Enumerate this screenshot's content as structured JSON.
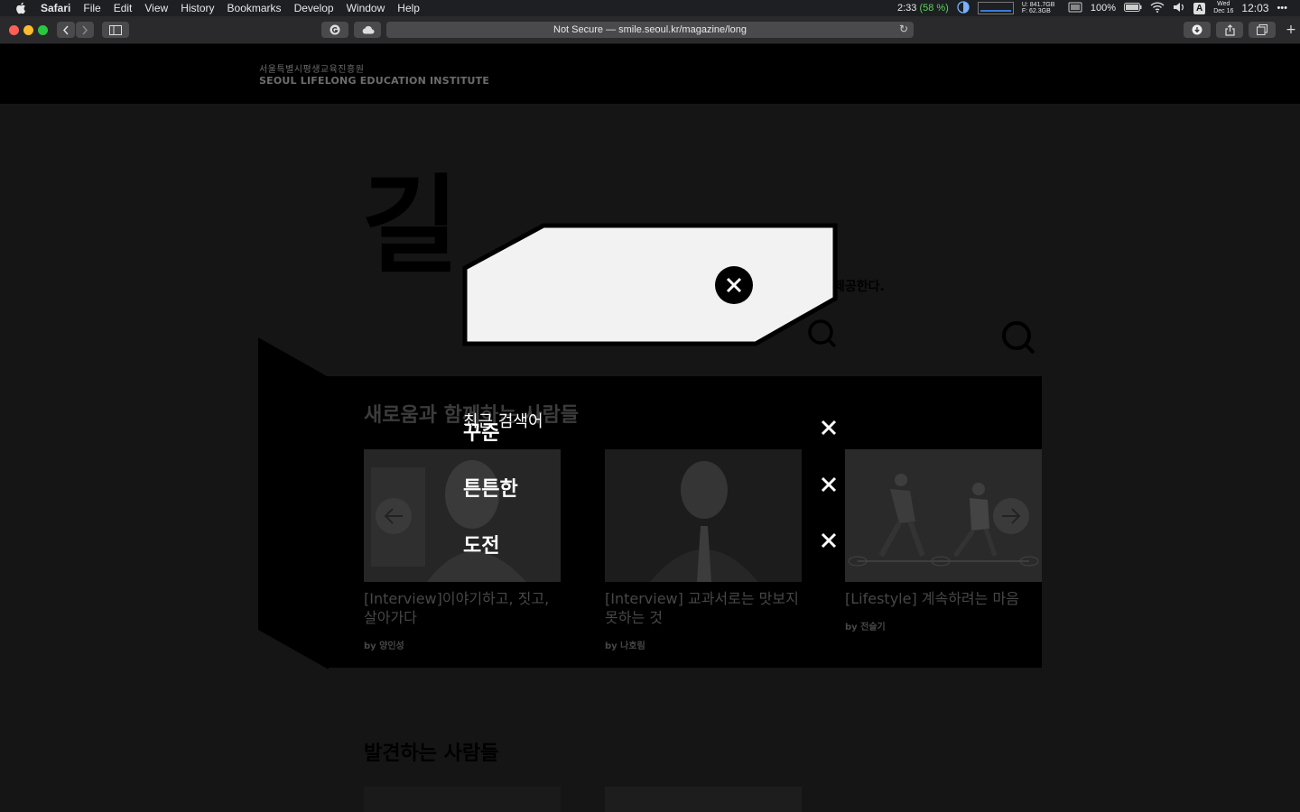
{
  "menubar": {
    "app": "Safari",
    "items": [
      "File",
      "Edit",
      "View",
      "History",
      "Bookmarks",
      "Develop",
      "Window",
      "Help"
    ],
    "status": {
      "time": "2:33",
      "battery_pct": "(58 %)",
      "mem_u": "U: 841.7GB",
      "mem_f": "F:  62.3GB",
      "battery_full": "100%",
      "input": "A",
      "day": "Wed",
      "date": "Dec 16",
      "clock": "12:03",
      "more": "•••"
    }
  },
  "browser": {
    "address": "Not Secure — smile.seoul.kr/magazine/long"
  },
  "site": {
    "logo_ko": "서울특별시평생교육진흥원",
    "logo_en": "SEOUL LIFELONG EDUCATION INSTITUTE",
    "big_title": "길",
    "tagline": "하는 사람들을 제공한다.",
    "section1_title": "새로움과 함께하는 사람들",
    "cards": [
      {
        "title": "[Interview]이야기하고, 짓고, 살아가다",
        "by": "by 양인성"
      },
      {
        "title": "[Interview] 교과서로는 맛보지 못하는 것",
        "by": "by 나호림"
      },
      {
        "title": "[Lifestyle] 계속하려는 마음",
        "by": "by 전슬기"
      }
    ],
    "section2_title": "발견하는 사람들"
  },
  "search": {
    "placeholder": "",
    "recent_heading": "최근 검색어",
    "recent": [
      {
        "term": "꾸준"
      },
      {
        "term": "튼튼한"
      },
      {
        "term": "도전"
      }
    ]
  }
}
